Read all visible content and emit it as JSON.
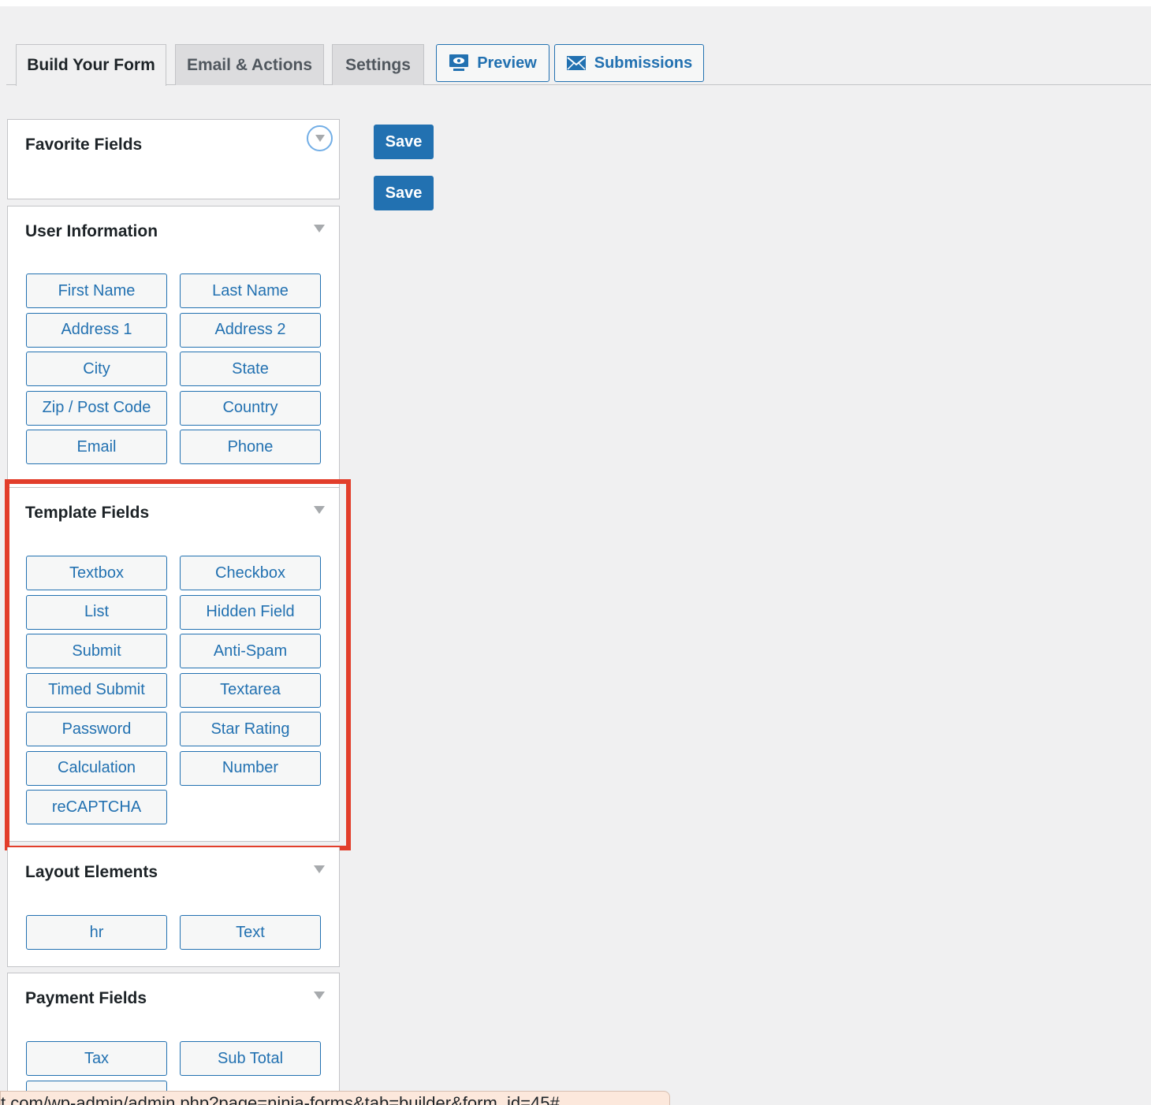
{
  "tabs": {
    "build": "Build Your Form",
    "email": "Email & Actions",
    "settings": "Settings",
    "preview": "Preview",
    "submissions": "Submissions"
  },
  "save_buttons": [
    "Save",
    "Save"
  ],
  "panels": {
    "favorite": {
      "title": "Favorite Fields"
    },
    "user": {
      "title": "User Information",
      "fields": [
        "First Name",
        "Last Name",
        "Address 1",
        "Address 2",
        "City",
        "State",
        "Zip / Post Code",
        "Country",
        "Email",
        "Phone"
      ]
    },
    "template": {
      "title": "Template Fields",
      "fields": [
        "Textbox",
        "Checkbox",
        "List",
        "Hidden Field",
        "Submit",
        "Anti-Spam",
        "Timed Submit",
        "Textarea",
        "Password",
        "Star Rating",
        "Calculation",
        "Number",
        "reCAPTCHA"
      ]
    },
    "layout": {
      "title": "Layout Elements",
      "fields": [
        "hr",
        "Text"
      ]
    },
    "payment": {
      "title": "Payment Fields",
      "fields": [
        "Tax",
        "Sub Total"
      ]
    }
  },
  "status_url": "t.com/wp-admin/admin.php?page=ninja-forms&tab=builder&form_id=45#",
  "colors": {
    "accent": "#2271b1",
    "highlight": "#e23e2b"
  }
}
